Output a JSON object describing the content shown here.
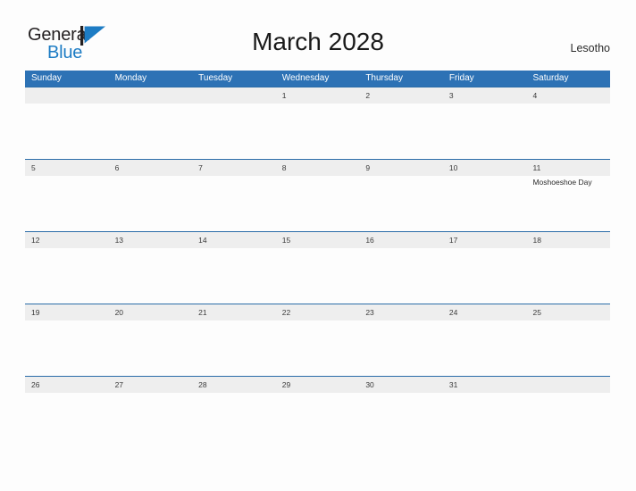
{
  "brand": {
    "name_part1": "General",
    "name_part2": "Blue",
    "mark": "triangle-logo-icon",
    "accent_color": "#1d7cc4"
  },
  "header": {
    "title": "March 2028",
    "country": "Lesotho"
  },
  "theme": {
    "header_blue": "#2d72b5",
    "row_divider_blue": "#2a6ca8",
    "date_strip_gray": "#eeeeee",
    "page_background": "#fdfdfd"
  },
  "calendar": {
    "weekdays": [
      "Sunday",
      "Monday",
      "Tuesday",
      "Wednesday",
      "Thursday",
      "Friday",
      "Saturday"
    ],
    "weeks": [
      {
        "days": [
          {
            "date": "",
            "event": ""
          },
          {
            "date": "",
            "event": ""
          },
          {
            "date": "",
            "event": ""
          },
          {
            "date": "1",
            "event": ""
          },
          {
            "date": "2",
            "event": ""
          },
          {
            "date": "3",
            "event": ""
          },
          {
            "date": "4",
            "event": ""
          }
        ]
      },
      {
        "days": [
          {
            "date": "5",
            "event": ""
          },
          {
            "date": "6",
            "event": ""
          },
          {
            "date": "7",
            "event": ""
          },
          {
            "date": "8",
            "event": ""
          },
          {
            "date": "9",
            "event": ""
          },
          {
            "date": "10",
            "event": ""
          },
          {
            "date": "11",
            "event": "Moshoeshoe Day"
          }
        ]
      },
      {
        "days": [
          {
            "date": "12",
            "event": ""
          },
          {
            "date": "13",
            "event": ""
          },
          {
            "date": "14",
            "event": ""
          },
          {
            "date": "15",
            "event": ""
          },
          {
            "date": "16",
            "event": ""
          },
          {
            "date": "17",
            "event": ""
          },
          {
            "date": "18",
            "event": ""
          }
        ]
      },
      {
        "days": [
          {
            "date": "19",
            "event": ""
          },
          {
            "date": "20",
            "event": ""
          },
          {
            "date": "21",
            "event": ""
          },
          {
            "date": "22",
            "event": ""
          },
          {
            "date": "23",
            "event": ""
          },
          {
            "date": "24",
            "event": ""
          },
          {
            "date": "25",
            "event": ""
          }
        ]
      },
      {
        "days": [
          {
            "date": "26",
            "event": ""
          },
          {
            "date": "27",
            "event": ""
          },
          {
            "date": "28",
            "event": ""
          },
          {
            "date": "29",
            "event": ""
          },
          {
            "date": "30",
            "event": ""
          },
          {
            "date": "31",
            "event": ""
          },
          {
            "date": "",
            "event": ""
          }
        ]
      }
    ]
  }
}
